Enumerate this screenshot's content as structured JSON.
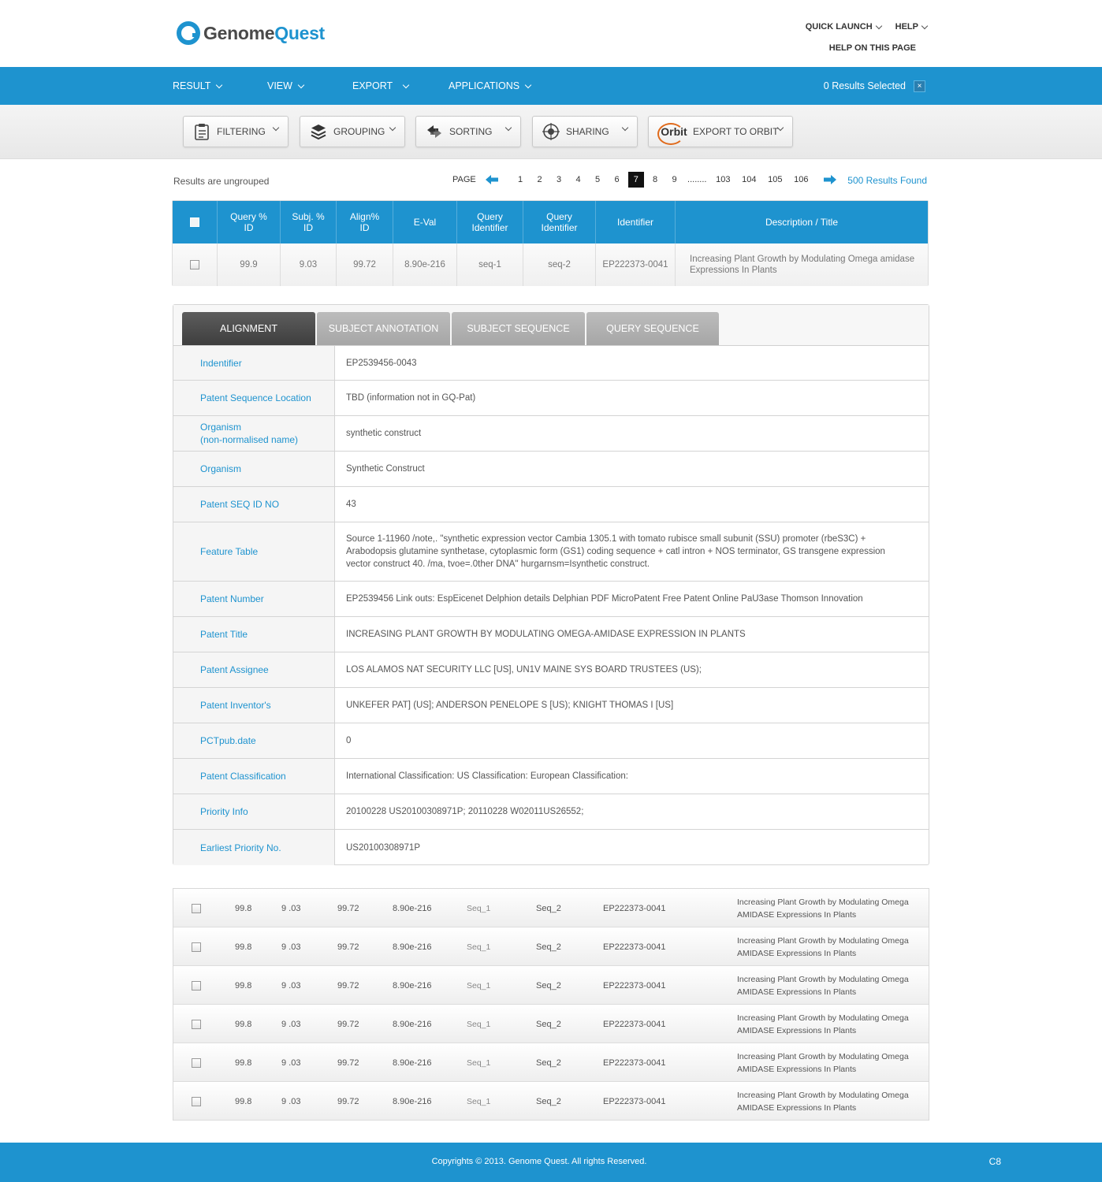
{
  "header": {
    "logo_prefix": "Genome",
    "logo_suffix": "Quest",
    "quick_launch": "QUICK LAUNCH",
    "help": "HELP",
    "help_on_page": "HELP ON THIS PAGE"
  },
  "nav": {
    "items": [
      "RESULT",
      "VIEW",
      "EXPORT",
      "APPLICATIONS"
    ],
    "results_selected": "0 Results Selected",
    "close": "×"
  },
  "toolbar": {
    "filtering": "FILTERING",
    "grouping": "GROUPING",
    "sorting": "SORTING",
    "sharing": "SHARING",
    "orbit_logo": "Orbit",
    "export_orbit": "EXPORT TO ORBIT"
  },
  "results": {
    "ungrouped": "Results are ungrouped",
    "page_label": "PAGE",
    "pages": [
      "1",
      "2",
      "3",
      "4",
      "5",
      "6",
      "7",
      "8",
      "9",
      "........",
      "103",
      "104",
      "105",
      "106"
    ],
    "active_page": "7",
    "found": "500 Results Found"
  },
  "table": {
    "headers": {
      "query_pct": "Query %\nID",
      "subj_pct": "Subj. %\nID",
      "align_pct": "Align%\nID",
      "eval": "E-Val",
      "query_id1": "Query\nIdentifier",
      "query_id2": "Query\nIdentifier",
      "identifier": "Identifier",
      "description": "Description / Title"
    },
    "row": {
      "query_pct": "99.9",
      "subj_pct": "9.03",
      "align_pct": "99.72",
      "eval": "8.90e-216",
      "query_id1": "seq-1",
      "query_id2": "seq-2",
      "identifier": "EP222373-0041",
      "description": "Increasing Plant Growth by Modulating  Omega amidase Expressions In Plants"
    }
  },
  "tabs": {
    "alignment": "ALIGNMENT",
    "subject_annotation": "SUBJECT ANNOTATION",
    "subject_sequence": "SUBJECT SEQUENCE",
    "query_sequence": "QUERY SEQUENCE"
  },
  "details": [
    {
      "label": "Indentifier",
      "value": "EP2539456-0043"
    },
    {
      "label": "Patent Sequence Location",
      "value": "TBD (information not in GQ-Pat)"
    },
    {
      "label": "Organism\n(non-normalised name)",
      "value": "synthetic construct"
    },
    {
      "label": "Organism",
      "value": "Synthetic Construct"
    },
    {
      "label": "Patent SEQ ID NO",
      "value": "43"
    },
    {
      "label": "Feature Table",
      "value": "Source 1-11960 /note,. \"synthetic expression vector Cambia 1305.1 with tomato rubisce small subunit (SSU) promoter (rbeS3C) + Arabodopsis glutamine synthetase, cytoplasmic form (GS1) coding sequence + catl intron + NOS terminator, GS transgene expression vector construct 40. /ma, tvoe=.0ther DNA\" hurgarnsm=Isynthetic construct."
    },
    {
      "label": "Patent Number",
      "value": "EP2539456 Link outs: EspEicenet Delphion details Delphian PDF MicroPatent Free Patent Online PaU3ase Thomson Innovation"
    },
    {
      "label": "Patent  Title",
      "value": "INCREASING PLANT GROWTH BY MODULATING OMEGA-AMIDASE EXPRESSION IN PLANTS"
    },
    {
      "label": "Patent  Assignee",
      "value": "LOS ALAMOS NAT SECURITY LLC [US], UN1V MAINE SYS BOARD TRUSTEES (US);"
    },
    {
      "label": "Patent  Inventor's",
      "value": "UNKEFER PAT] (US]; ANDERSON PENELOPE S [US); KNIGHT THOMAS I [US]"
    },
    {
      "label": "PCTpub.date",
      "value": "0"
    },
    {
      "label": "Patent Classification",
      "value": "International Classification: US Classification: European Classification:"
    },
    {
      "label": "Priority Info",
      "value": "20100228 US20100308971P; 20110228 W02011US26552;"
    },
    {
      "label": "Earliest Priority No.",
      "value": "US20100308971P"
    }
  ],
  "list": [
    {
      "q": "99.8",
      "s": "9 .03",
      "a": "99.72",
      "e": "8.90e-216",
      "id1": "Seq_1",
      "id2": "Seq_2",
      "ident": "EP222373-0041",
      "desc": "Increasing Plant Growth by Modulating  Omega AMIDASE Expressions In Plants"
    },
    {
      "q": "99.8",
      "s": "9 .03",
      "a": "99.72",
      "e": "8.90e-216",
      "id1": "Seq_1",
      "id2": "Seq_2",
      "ident": "EP222373-0041",
      "desc": "Increasing Plant Growth by Modulating  Omega AMIDASE Expressions In Plants"
    },
    {
      "q": "99.8",
      "s": "9 .03",
      "a": "99.72",
      "e": "8.90e-216",
      "id1": "Seq_1",
      "id2": "Seq_2",
      "ident": "EP222373-0041",
      "desc": "Increasing Plant Growth by Modulating  Omega AMIDASE Expressions In Plants"
    },
    {
      "q": "99.8",
      "s": "9 .03",
      "a": "99.72",
      "e": "8.90e-216",
      "id1": "Seq_1",
      "id2": "Seq_2",
      "ident": "EP222373-0041",
      "desc": "Increasing Plant Growth by Modulating  Omega AMIDASE Expressions In Plants"
    },
    {
      "q": "99.8",
      "s": "9 .03",
      "a": "99.72",
      "e": "8.90e-216",
      "id1": "Seq_1",
      "id2": "Seq_2",
      "ident": "EP222373-0041",
      "desc": "Increasing Plant Growth by Modulating  Omega AMIDASE Expressions In Plants"
    },
    {
      "q": "99.8",
      "s": "9 .03",
      "a": "99.72",
      "e": "8.90e-216",
      "id1": "Seq_1",
      "id2": "Seq_2",
      "ident": "EP222373-0041",
      "desc": "Increasing Plant Growth by Modulating  Omega AMIDASE Expressions In Plants"
    }
  ],
  "footer": {
    "copyright": "Copyrights © 2013. Genome Quest. All rights Reserved.",
    "code": "C8"
  },
  "colors": {
    "brand_blue": "#1e93cf",
    "active_tab": "#4a4a4a",
    "inactive_tab": "#b0b0b0"
  }
}
